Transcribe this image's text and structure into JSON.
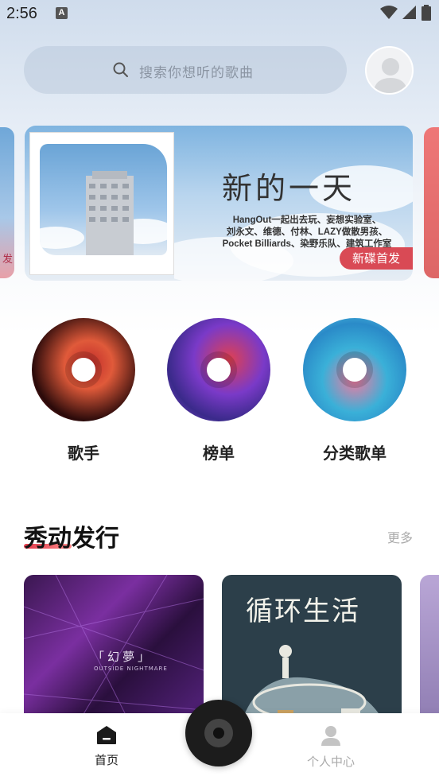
{
  "status_bar": {
    "time": "2:56",
    "notification_badge": "A",
    "icons": [
      "wifi-icon",
      "signal-icon",
      "battery-icon"
    ]
  },
  "search": {
    "placeholder": "搜索你想听的歌曲"
  },
  "banner": {
    "title": "新的一天",
    "subtitle_lines": [
      "HangOut一起出去玩、妄想实验室、",
      "刘永文、维德、付林、LAZY做散男孩、",
      "Pocket Billiards、染野乐队、建筑工作室"
    ],
    "badge": "新碟首发",
    "left_peek_text": "发"
  },
  "categories": [
    {
      "label": "歌手"
    },
    {
      "label": "榜单"
    },
    {
      "label": "分类歌单"
    }
  ],
  "section": {
    "title": "秀动发行",
    "more": "更多"
  },
  "albums": [
    {
      "title": "「幻夢」",
      "subtitle": "OUTSIDE NIGHTMARE"
    },
    {
      "title": "循环生活"
    }
  ],
  "bottom_nav": {
    "home": "首页",
    "profile": "个人中心"
  },
  "colors": {
    "accent": "#d94a55",
    "underline": "#e03a4a"
  }
}
